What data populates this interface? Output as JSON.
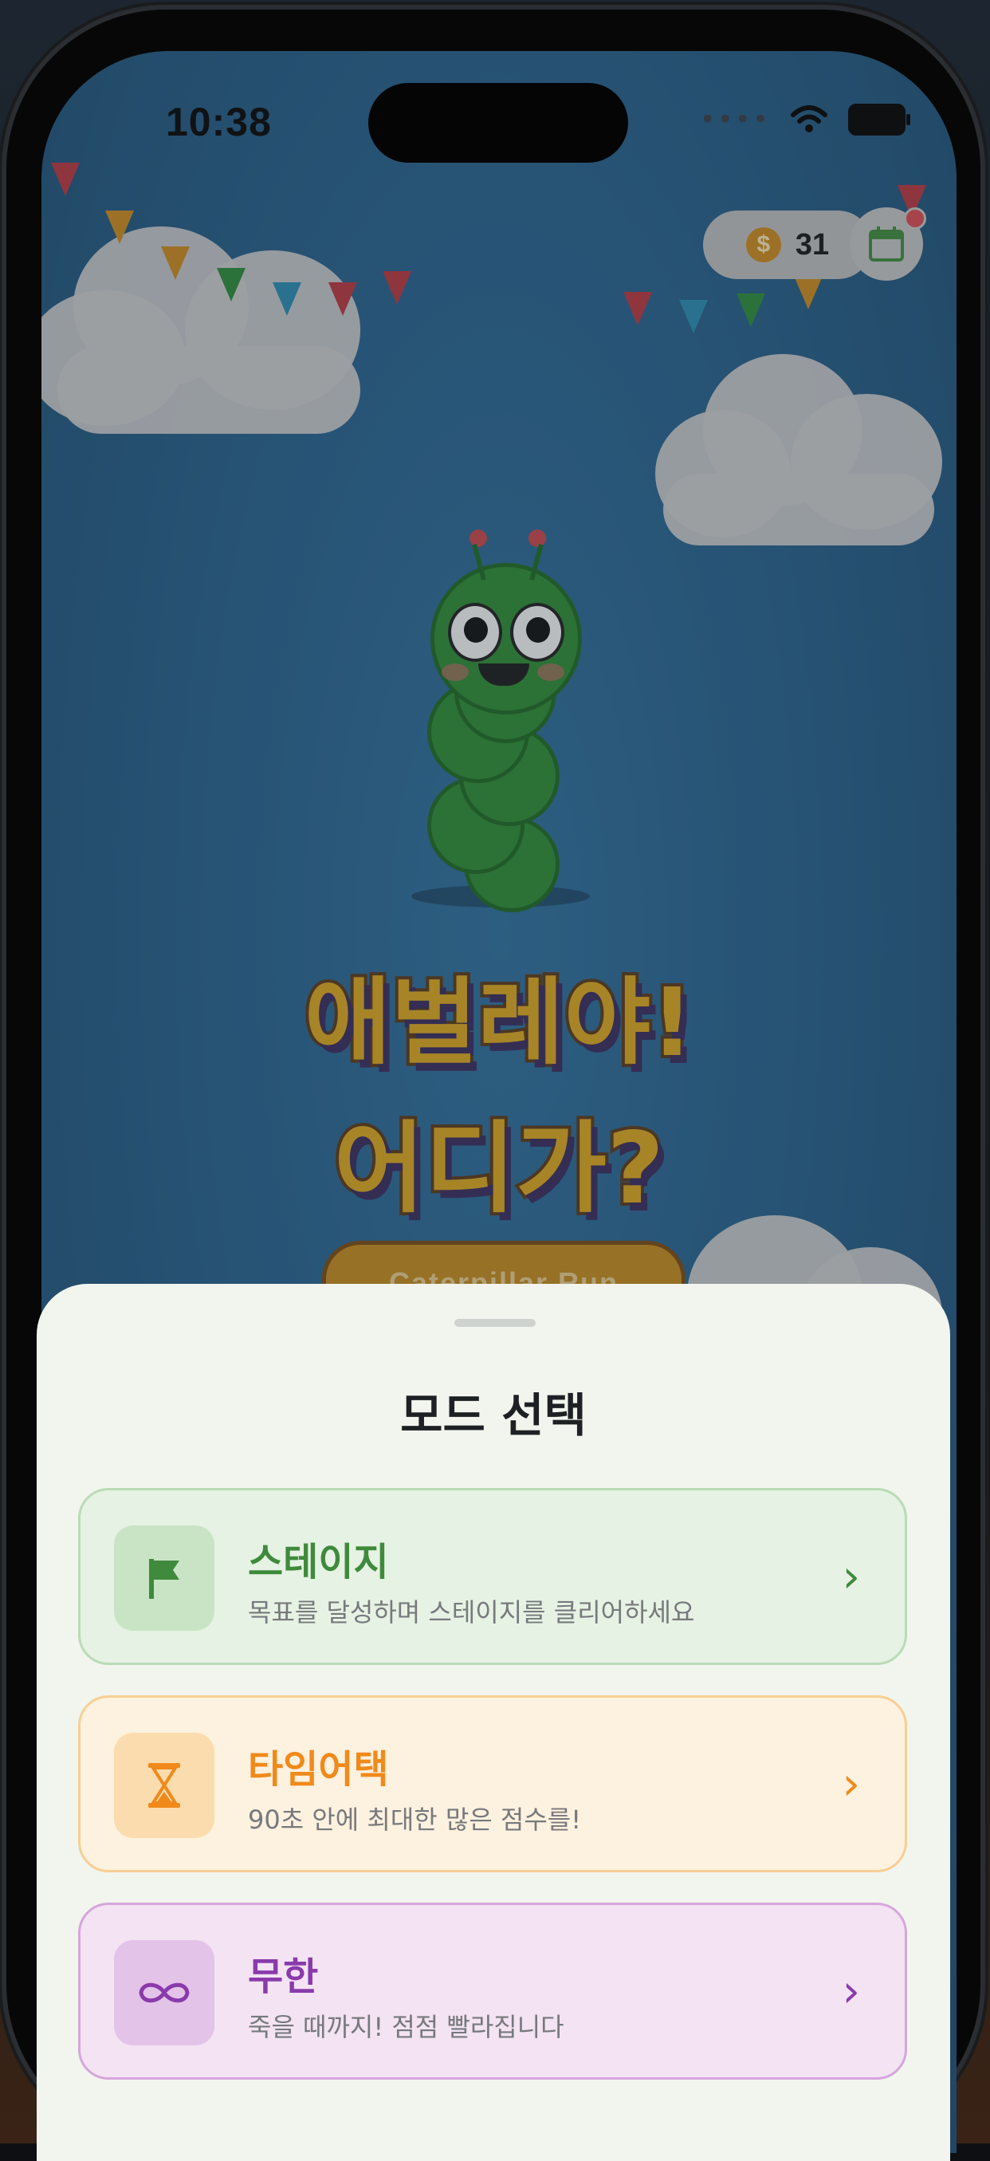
{
  "status_bar": {
    "time": "10:38",
    "signal_dots": "••••"
  },
  "header": {
    "coins": "31",
    "coin_symbol": "$"
  },
  "game": {
    "title_line1": "애벌레야!",
    "title_line2": "어디가?",
    "subtitle": "Caterpillar Run"
  },
  "mode_sheet": {
    "title": "모드 선택",
    "modes": [
      {
        "label": "스테이지",
        "desc": "목표를 달성하며 스테이지를 클리어하세요",
        "icon": "flag-icon",
        "color": "#3f8a3c",
        "bg": "#e6f2e3",
        "border": "#b9dbb6",
        "icon_bg": "#c9e4c5"
      },
      {
        "label": "타임어택",
        "desc": "90초 안에 최대한 많은 점수를!",
        "icon": "hourglass-icon",
        "color": "#f08a1a",
        "bg": "#fdf1df",
        "border": "#f6cf94",
        "icon_bg": "#fbdcae"
      },
      {
        "label": "무한",
        "desc": "죽을 때까지! 점점 빨라집니다",
        "icon": "infinity-icon",
        "color": "#8a3bab",
        "bg": "#f3e3f3",
        "border": "#d6a6dc",
        "icon_bg": "#e4c3e9"
      }
    ],
    "chevron": "›"
  }
}
